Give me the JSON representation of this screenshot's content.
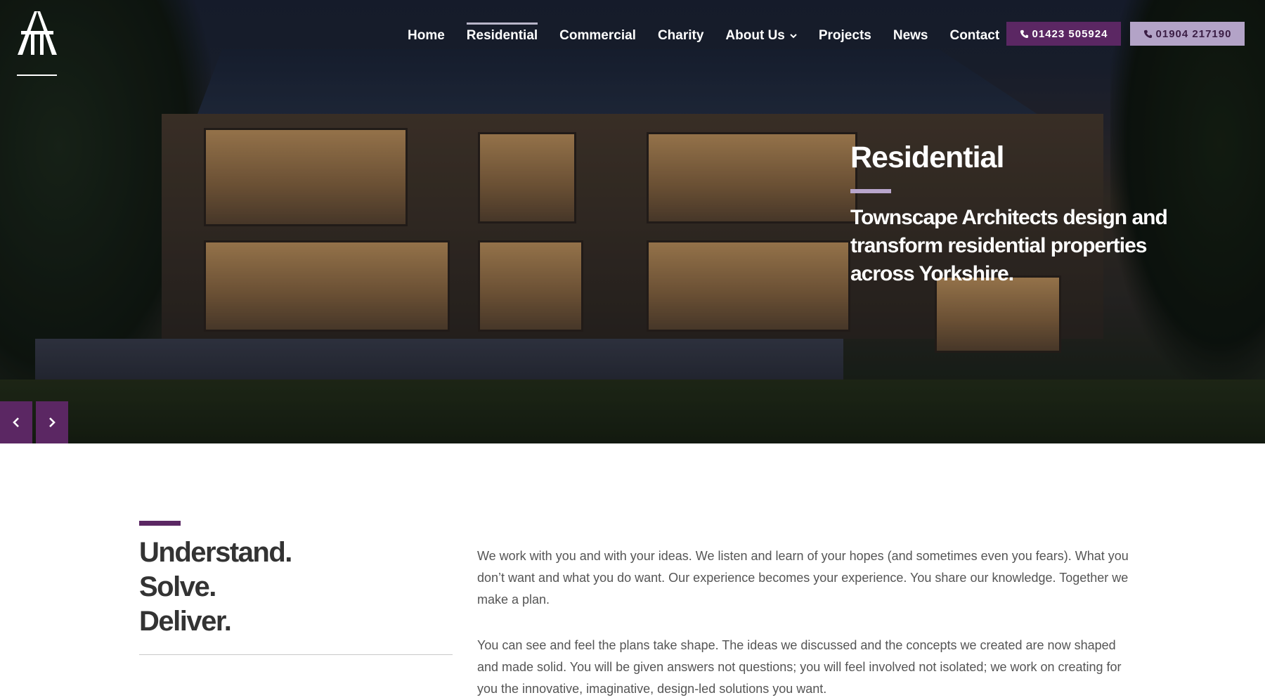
{
  "brand": {
    "logo_icon": "townscape-architects-logo"
  },
  "nav": {
    "items": [
      {
        "label": "Home",
        "active": false
      },
      {
        "label": "Residential",
        "active": true
      },
      {
        "label": "Commercial",
        "active": false
      },
      {
        "label": "Charity",
        "active": false
      },
      {
        "label": "About Us",
        "active": false,
        "has_dropdown": true
      },
      {
        "label": "Projects",
        "active": false
      },
      {
        "label": "News",
        "active": false
      },
      {
        "label": "Contact",
        "active": false
      }
    ],
    "phones": [
      {
        "number": "01423 505924",
        "icon": "phone-icon"
      },
      {
        "number": "01904 217190",
        "icon": "phone-icon"
      }
    ]
  },
  "hero": {
    "title": "Residential",
    "subtitle": "Townscape Architects design and transform residential properties across Yorkshire.",
    "prev_icon": "chevron-left-icon",
    "next_icon": "chevron-right-icon"
  },
  "intro": {
    "tagline": [
      "Understand.",
      "Solve.",
      "Deliver."
    ],
    "paragraphs": [
      "We work with you and with your ideas. We listen and learn of your hopes (and sometimes even you fears). What you don’t want and what you do want. Our experience becomes your experience. You share our knowledge.  Together we make a plan.",
      "You can see and feel the plans take shape. The ideas we discussed and the concepts we created are now shaped and made solid. You will be given answers not questions; you will feel involved not isolated; we work on creating for you the innovative, imaginative, design-led solutions you want."
    ]
  },
  "colors": {
    "brand_purple": "#5b2763",
    "light_purple": "#b3a3c7",
    "heading_text": "#333333",
    "body_text": "#555555"
  }
}
